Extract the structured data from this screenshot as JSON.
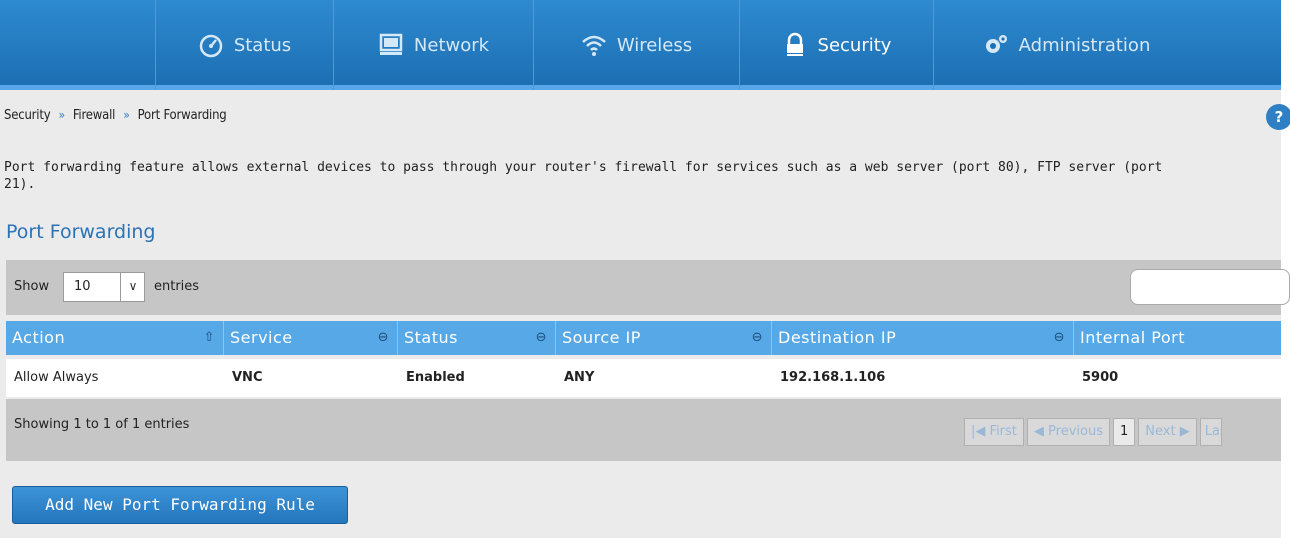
{
  "nav": {
    "items": [
      {
        "label": "Status",
        "icon": "dashboard-icon"
      },
      {
        "label": "Network",
        "icon": "monitor-icon"
      },
      {
        "label": "Wireless",
        "icon": "wifi-icon"
      },
      {
        "label": "Security",
        "icon": "lock-icon"
      },
      {
        "label": "Administration",
        "icon": "gears-icon"
      }
    ],
    "active": "Security"
  },
  "breadcrumb": {
    "items": [
      "Security",
      "Firewall",
      "Port Forwarding"
    ],
    "separator": "»"
  },
  "help_label": "?",
  "description": "Port forwarding feature allows external devices to pass through your router's firewall for services such as a web server (port 80), FTP server (port\n21).",
  "section_title": "Port Forwarding",
  "table_controls": {
    "show_label": "Show",
    "page_size": "10",
    "entries_label": "entries",
    "search_value": ""
  },
  "table": {
    "columns": [
      "Action",
      "Service",
      "Status",
      "Source IP",
      "Destination IP",
      "Internal Port"
    ],
    "rows": [
      [
        "Allow Always",
        "VNC",
        "Enabled",
        "ANY",
        "192.168.1.106",
        "5900"
      ]
    ]
  },
  "footer": {
    "info": "Showing 1 to 1 of 1 entries",
    "pager": {
      "first": "First",
      "previous": "Previous",
      "current": "1",
      "next": "Next",
      "last": "Last"
    }
  },
  "add_button_label": "Add New Port Forwarding Rule",
  "colors": {
    "nav_bg": "#1d6fb3",
    "accent": "#2a73b6",
    "table_header": "#56a8e6"
  }
}
